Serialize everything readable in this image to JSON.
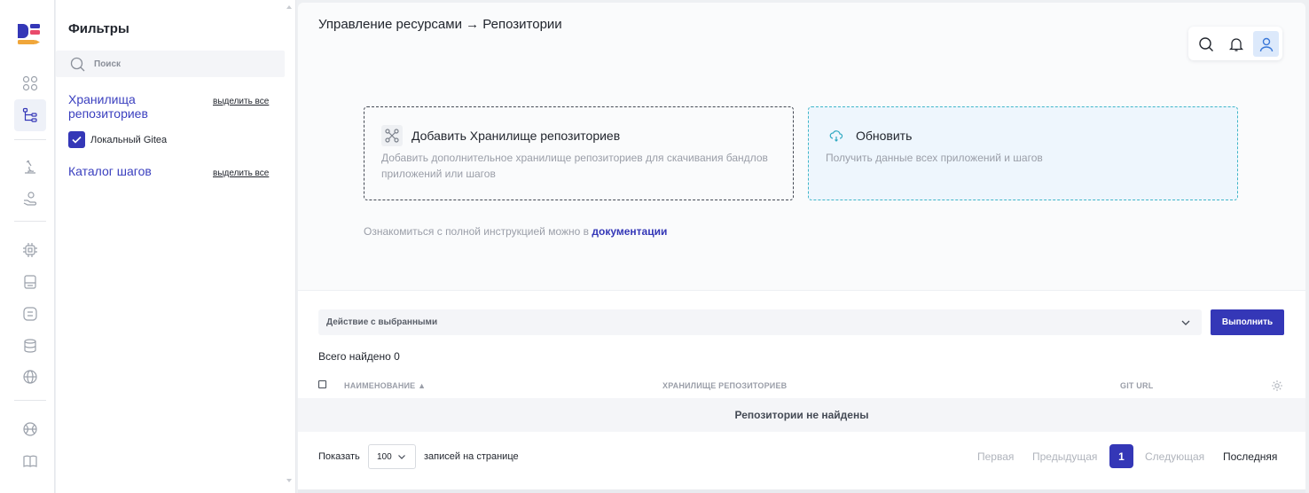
{
  "colors": {
    "accent": "#3437b7",
    "group_title": "#3a3fbf",
    "refresh_border": "#40b6c9",
    "refresh_bg": "#eef6fd",
    "muted_text": "#9a9ea8"
  },
  "rail": {
    "icons": [
      "dashboard-grid-icon",
      "resource-tree-icon",
      "microscope-icon",
      "hand-gear-icon",
      "chip-icon",
      "storage-icon",
      "menu-list-icon",
      "database-icon",
      "globe-icon",
      "network-globe-icon",
      "book-icon"
    ]
  },
  "filters": {
    "title": "Фильтры",
    "search_placeholder": "Поиск",
    "groups": [
      {
        "title": "Хранилища репозиториев",
        "select_all": "выделить все",
        "options": [
          {
            "label": "Локальный Gitea",
            "checked": true
          }
        ]
      },
      {
        "title": "Каталог шагов",
        "select_all": "выделить все",
        "options": []
      }
    ]
  },
  "header": {
    "breadcrumb": "Управление ресурсами → Репозитории",
    "tools": [
      "search-icon",
      "bell-icon",
      "user-icon"
    ]
  },
  "cards": {
    "add": {
      "title": "Добавить Хранилище репозиториев",
      "description": "Добавить дополнительное хранилище репозиториев для скачивания бандлов приложений или шагов"
    },
    "refresh": {
      "title": "Обновить",
      "description": "Получить данные всех приложений и шагов"
    }
  },
  "docs": {
    "text": "Ознакомиться с полной инструкцией можно в ",
    "link": "документации"
  },
  "table": {
    "action_placeholder": "Действие с выбранными",
    "run_button": "Выполнить",
    "total": "Всего найдено 0",
    "columns": [
      "НАИМЕНОВАНИЕ ▲",
      "ХРАНИЛИЩЕ РЕПОЗИТОРИЕВ",
      "GIT URL"
    ],
    "empty": "Репозитории не найдены"
  },
  "pagination": {
    "show_label": "Показать",
    "per_page": "100",
    "records_label": "записей на странице",
    "first": "Первая",
    "prev": "Предыдущая",
    "current": "1",
    "next": "Следующая",
    "last": "Последняя"
  }
}
